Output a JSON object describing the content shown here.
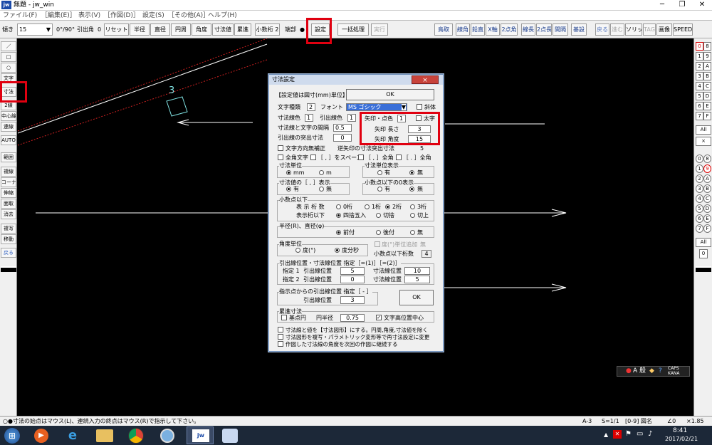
{
  "window": {
    "title": "無題 - jw_win",
    "icon_text": "jw"
  },
  "menu": [
    "ファイル(F)",
    "［編集(E)］",
    "表示(V)",
    "［作図(D)］",
    "設定(S)",
    "［その他(A)］",
    "ヘルプ(H)"
  ],
  "toolbar": {
    "slope_label": "傾き",
    "slope_value": "15",
    "angle_toggle": "0°/90°",
    "leader_label": "引出角",
    "leader_value": "0",
    "reset": "リセット",
    "radius": "半径",
    "diameter": "直径",
    "circumference": "円周",
    "angle": "角度",
    "dim_value": "寸法値",
    "cumulative": "累進",
    "decimal": "小数桁",
    "decimal_value": "2",
    "endpoint": "端部",
    "settings": "設定",
    "batch": "一括処理",
    "execute": "実行",
    "right": [
      "鳥取",
      "線角",
      "鉛直",
      "X軸",
      "2点角",
      "線長",
      "2点長",
      "間隔",
      "基設",
      "戻る",
      "進む",
      "ソリッド",
      "TAG",
      "画像",
      "SPEED"
    ]
  },
  "left_tools": [
    "／",
    "□",
    "○",
    "文字",
    "寸法",
    "2線",
    "中心線",
    "連線",
    "AUTO",
    "範囲",
    "複線",
    "コーナー",
    "伸縮",
    "面取",
    "消去",
    "複写",
    "移動",
    "戻る"
  ],
  "right_tools": {
    "row1": [
      "0",
      "8",
      "1",
      "9",
      "2",
      "A",
      "3",
      "B",
      "4",
      "C",
      "5",
      "D",
      "6",
      "E",
      "7",
      "F"
    ],
    "all1": "All",
    "x": "×",
    "row2": [
      "0",
      "8",
      "1",
      "9",
      "2",
      "A",
      "3",
      "B",
      "4",
      "C",
      "5",
      "D",
      "6",
      "E",
      "7",
      "F"
    ],
    "all2": "All",
    "zero": "0"
  },
  "canvas": {
    "dim_number": "3"
  },
  "dialog": {
    "title": "寸法設定",
    "close": "×",
    "unit_note": "【設定値は図寸(mm)単位】",
    "ok": "OK",
    "font_type_label": "文字種類",
    "font_type_value": "2",
    "font_label": "フォント",
    "font_value": "MS ゴシック",
    "slant_label": "斜体",
    "dim_color_label": "寸法線色",
    "dim_color_value": "1",
    "leader_color_label": "引出線色",
    "leader_color_value": "1",
    "arrow_color_label": "矢印・点色",
    "arrow_color_value": "1",
    "bold_label": "太字",
    "gap_label": "寸法線と文字の間隔",
    "gap_value": "0.5",
    "arrow_len_label": "矢印 長さ",
    "arrow_len_value": "3",
    "protrude_label": "引出線の突出寸法",
    "protrude_value": "0",
    "arrow_angle_label": "矢印 角度",
    "arrow_angle_value": "15",
    "text_dir_label": "文字方向無補正",
    "reverse_arrow_label": "逆矢印の寸法突出寸法",
    "reverse_arrow_value": "5",
    "fullwidth_label": "全角文字",
    "comma_space_label": "［ , ］をスペース",
    "comma_full_label": "［ , ］全角",
    "period_full_label": "［ . ］全角",
    "unit_group": "寸法単位",
    "unit_mm": "mm",
    "unit_m": "m",
    "unit_show_group": "寸法単位表示",
    "unit_show_yes": "有",
    "unit_show_no": "無",
    "comma_group": "寸法値の［ , ］表示",
    "comma_yes": "有",
    "comma_no": "無",
    "zero_group": "小数点以下の0表示",
    "zero_yes": "有",
    "zero_no": "無",
    "decimal_group": "小数点以下",
    "digits_label": "表 示 桁 数",
    "d0": "0桁",
    "d1": "1桁",
    "d2": "2桁",
    "d3": "3桁",
    "round_label": "表示桁以下",
    "round1": "四捨五入",
    "round2": "切捨",
    "round3": "切上",
    "radius_group": "半径(R)、直径(φ)",
    "pre": "前付",
    "post": "後付",
    "none": "無",
    "angle_group": "角度単位",
    "deg": "度(°)",
    "dms": "度分秒",
    "deg_add_label": "度(°)単位追加",
    "deg_add_value": "無",
    "angle_decimal_label": "小数点以下桁数",
    "angle_decimal_value": "4",
    "leader_pos_group": "引出線位置・寸法線位置 指定［=(1)］［=(2)］",
    "spec1": "指定 1",
    "spec2": "指定 2",
    "leader_pos_label": "引出線位置",
    "dimline_pos_label": "寸法線位置",
    "spec1_leader": "5",
    "spec1_dim": "10",
    "spec2_leader": "0",
    "spec2_dim": "5",
    "pointer_group": "指示点からの引出線位置 指定［ - ］",
    "pointer_leader_label": "引出線位置",
    "pointer_leader_value": "3",
    "ok2": "OK",
    "cumulative_group": "累進寸法",
    "base_circle_label": "基点円",
    "circle_radius_label": "円半径",
    "circle_radius_value": "0.75",
    "text_center_label": "文字高位置中心",
    "opt1": "寸法線と値を【寸法図形】にする。円周,角度,寸法値を除く",
    "opt2": "寸法図形を複写・パラメトリック変形等で再寸法設定に変更",
    "opt3": "作図した寸法線の角度を次回の作図に継続する"
  },
  "status": {
    "hint": "○●寸法の始点はマウス(L)、連続入力の終点はマウス(R)で指示して下さい。",
    "paper": "A-3",
    "scale": "S=1/1",
    "layer": "[0-9] 図名",
    "angle": "∠0",
    "zoom": "×1.85"
  },
  "ime": {
    "mode": "A",
    "kana": "般",
    "caps": "CAPS",
    "kana_lock": "KANA"
  },
  "clock": {
    "time": "8:41",
    "date": "2017/02/21"
  },
  "colors": {
    "accent": "#e00010",
    "dim_line": "#7fe0e0",
    "dialog_title": "#cfdbed"
  }
}
